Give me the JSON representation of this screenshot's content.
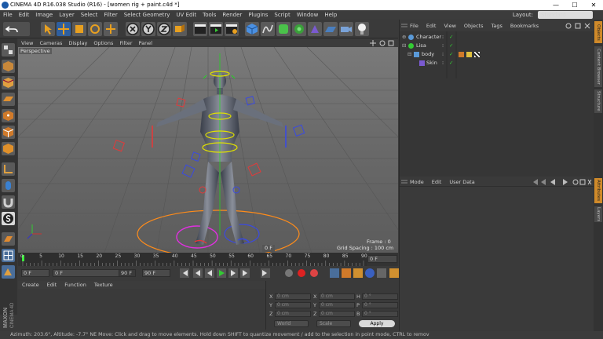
{
  "window": {
    "title": "CINEMA 4D R16.038 Studio (R16) - [women rig + paint.c4d *]",
    "minimize": "—",
    "maximize": "☐",
    "close": "✕"
  },
  "menu": {
    "items": [
      "File",
      "Edit",
      "Image",
      "Layer",
      "Select",
      "Filter",
      "Select Geometry",
      "UV Edit",
      "Tools",
      "Render",
      "Plugins",
      "Script",
      "Window",
      "Help"
    ],
    "layout_label": "Layout:",
    "layout_value": "Standard"
  },
  "viewport": {
    "menu": [
      "View",
      "Cameras",
      "Display",
      "Options",
      "Filter",
      "Panel"
    ],
    "camera_label": "Perspective",
    "frame_text": "Frame : 0",
    "grid_spacing": "Grid Spacing : 100 cm",
    "frame_field": "0 F"
  },
  "timeline": {
    "ticks": [
      "0",
      "5",
      "10",
      "15",
      "20",
      "25",
      "30",
      "35",
      "40",
      "45",
      "50",
      "55",
      "60",
      "65",
      "70",
      "75",
      "80",
      "85",
      "90"
    ],
    "current_frame": "0 F",
    "start_field": "0 F",
    "min_field": "0 F",
    "max_field": "90 F",
    "end_field": "90 F"
  },
  "material_manager": {
    "menu": [
      "Create",
      "Edit",
      "Function",
      "Texture"
    ]
  },
  "coordinates": {
    "row1": {
      "a": "X",
      "av": "0 cm",
      "b": "X",
      "bv": "0 cm",
      "c": "H",
      "cv": "0 °"
    },
    "row2": {
      "a": "Y",
      "av": "0 cm",
      "b": "Y",
      "bv": "0 cm",
      "c": "P",
      "cv": "0 °"
    },
    "row3": {
      "a": "Z",
      "av": "0 cm",
      "b": "Z",
      "bv": "0 cm",
      "c": "B",
      "cv": "0 °"
    },
    "mode": "World",
    "scale": "Scale",
    "apply": "Apply"
  },
  "object_manager": {
    "menu": [
      "File",
      "Edit",
      "View",
      "Objects",
      "Tags",
      "Bookmarks"
    ],
    "objects": [
      {
        "name": "Character",
        "indent": 0
      },
      {
        "name": "Lisa",
        "indent": 0
      },
      {
        "name": "body",
        "indent": 1
      },
      {
        "name": "Skin",
        "indent": 2
      }
    ]
  },
  "attribute_manager": {
    "menu": [
      "Mode",
      "Edit",
      "User Data"
    ]
  },
  "right_tabs": [
    "Objects",
    "Content Browser",
    "Structure",
    "Attributes",
    "Layers"
  ],
  "branding": {
    "line1": "MAXON",
    "line2": "CINEMA 4D"
  },
  "status": {
    "text": "Azimuth: 203.6°, Altitude: -7.7°  NE     Move: Click and drag to move elements. Hold down SHIFT to quantize movement / add to the selection in point mode, CTRL to remov"
  },
  "colors": {
    "ui_bg": "#3a3a3a",
    "viewport_bg": "#6e6e6e",
    "accent_yellow": "#e0e000",
    "accent_green": "#22d422",
    "rig_red": "#e23a3a",
    "rig_blue": "#3a4ae2",
    "rig_orange": "#ff8c1a",
    "rig_magenta": "#e030e0",
    "playhead": "#3af03a"
  }
}
